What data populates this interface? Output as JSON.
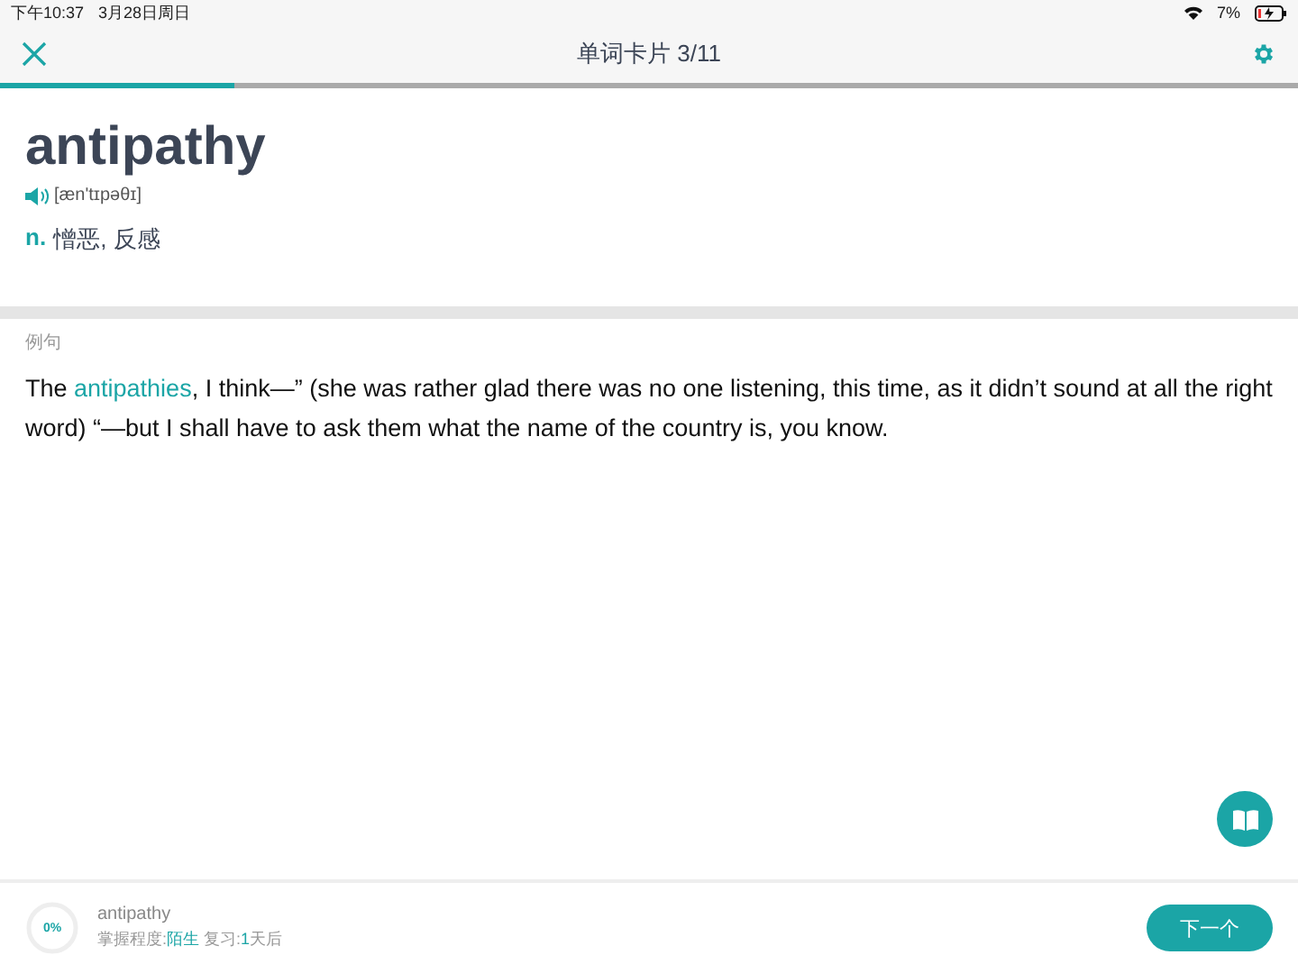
{
  "status_bar": {
    "time": "下午10:37",
    "date": "3月28日周日",
    "battery": "7%"
  },
  "header": {
    "title": "单词卡片 3/11",
    "progress": {
      "level": 0.18
    }
  },
  "word": {
    "headword": "antipathy",
    "phonetic": "[æn'tɪpəθɪ]",
    "pos": "n.",
    "meaning": "憎恶, 反感"
  },
  "examples": {
    "label": "例句",
    "sentence": [
      {
        "text": "The ",
        "highlight": false
      },
      {
        "text": "antipathies",
        "highlight": true
      },
      {
        "text": ", I think—” (she was rather glad there was no one listening, this time, as it didn’t sound at all the right word) “—but I shall have to ask them what the name of the country is, you know.",
        "highlight": false
      }
    ]
  },
  "footer": {
    "mastery": {
      "level": 0,
      "label": "0%"
    },
    "word": "antipathy",
    "status": [
      {
        "text": "掌握程度:",
        "highlight": false
      },
      {
        "text": "陌生",
        "highlight": true
      },
      {
        "text": " 复习:",
        "highlight": false
      },
      {
        "text": "1",
        "highlight": true
      },
      {
        "text": "天后",
        "highlight": false
      }
    ],
    "next_button": "下一个"
  }
}
